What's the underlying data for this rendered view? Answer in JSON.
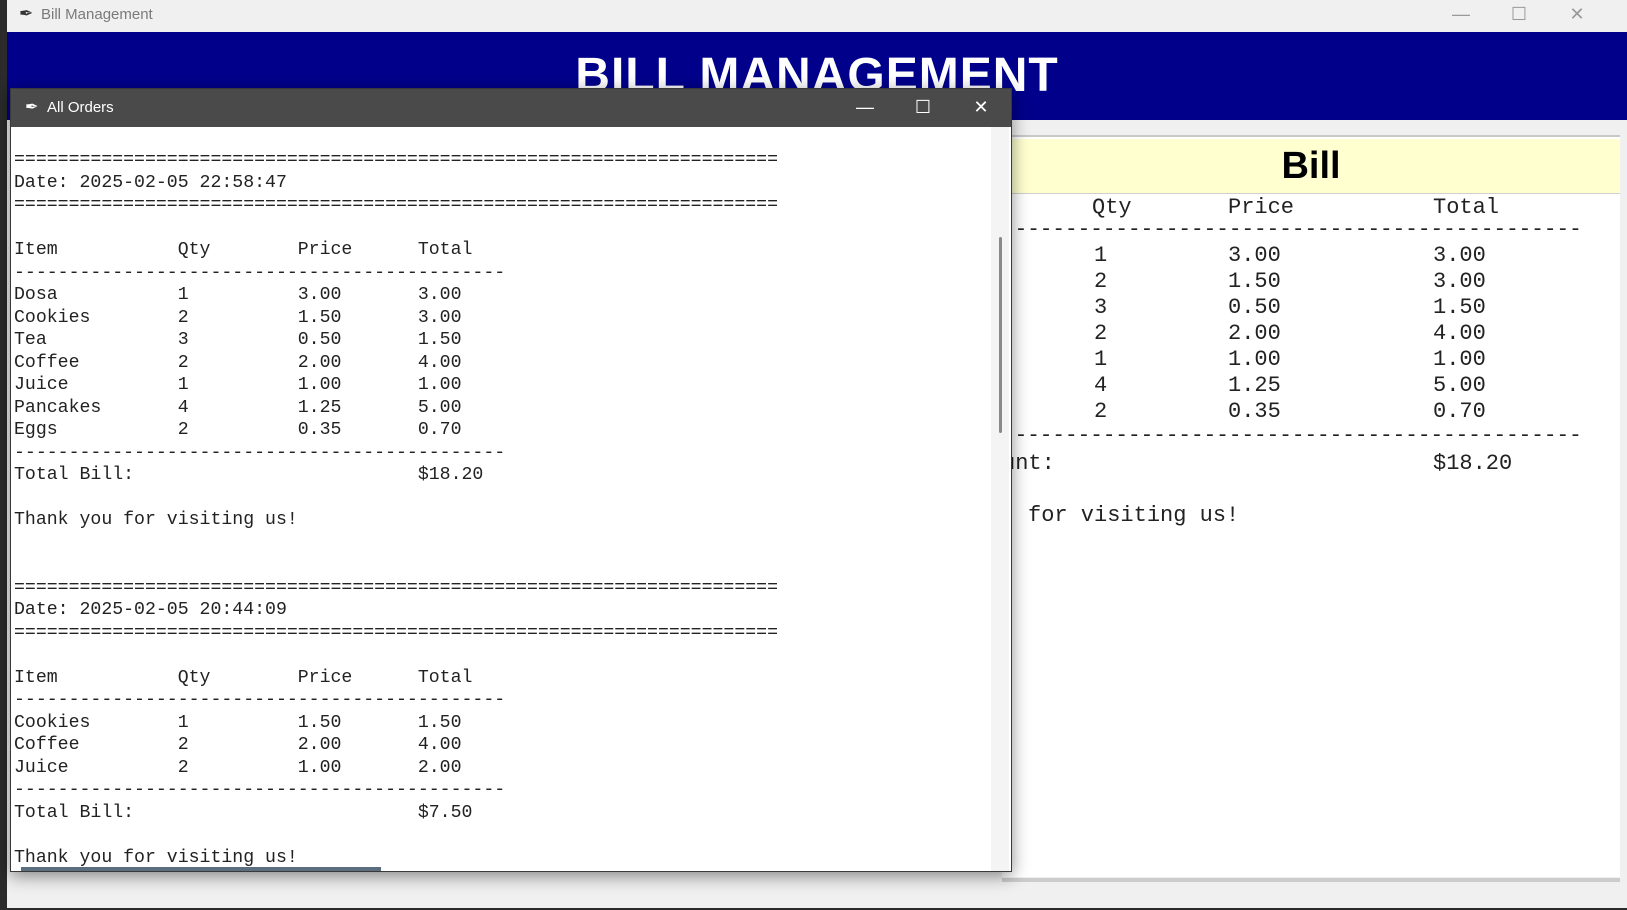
{
  "main_window": {
    "title": "Bill Management",
    "controls": {
      "minimize": "—",
      "maximize": "☐",
      "close": "✕"
    },
    "banner_text": "BILL MANAGEMENT"
  },
  "bill_panel": {
    "header": "Bill",
    "columns": [
      "Qty",
      "Price",
      "Total"
    ],
    "rule": "----------------------------------------------",
    "rows": [
      [
        "1",
        "3.00",
        "3.00"
      ],
      [
        "2",
        "1.50",
        "3.00"
      ],
      [
        "3",
        "0.50",
        "1.50"
      ],
      [
        "2",
        "2.00",
        "4.00"
      ],
      [
        "1",
        "1.00",
        "1.00"
      ],
      [
        "4",
        "1.25",
        "5.00"
      ],
      [
        "2",
        "0.35",
        "0.70"
      ]
    ],
    "total_label_visible": "unt:",
    "total_value": "$18.20",
    "thank_you_visible": "for visiting us!"
  },
  "orders_window": {
    "title": "All Orders",
    "controls": {
      "minimize": "—",
      "maximize": "☐",
      "close": "✕"
    },
    "text": "======================================================================\nDate: 2025-02-05 22:58:47\n======================================================================\n\nItem           Qty        Price      Total\n---------------------------------------------\nDosa           1          3.00       3.00\nCookies        2          1.50       3.00\nTea            3          0.50       1.50\nCoffee         2          2.00       4.00\nJuice          1          1.00       1.00\nPancakes       4          1.25       5.00\nEggs           2          0.35       0.70\n---------------------------------------------\nTotal Bill:                          $18.20\n\nThank you for visiting us!\n\n\n======================================================================\nDate: 2025-02-05 20:44:09\n======================================================================\n\nItem           Qty        Price      Total\n---------------------------------------------\nCookies        1          1.50       1.50\nCoffee         2          2.00       4.00\nJuice          2          1.00       2.00\n---------------------------------------------\nTotal Bill:                          $7.50\n\nThank you for visiting us!"
  }
}
